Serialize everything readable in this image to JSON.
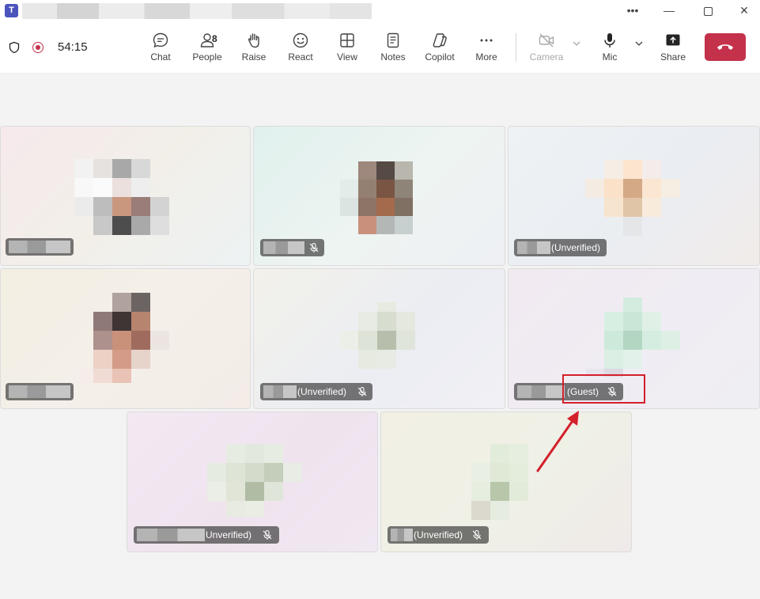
{
  "window": {
    "app_logo": "T",
    "app": "Microsoft Teams"
  },
  "titlebar": {
    "more_icon": "ellipsis-icon",
    "minimize_icon": "minimize-icon",
    "maximize_icon": "maximize-icon",
    "close_icon": "close-icon"
  },
  "status": {
    "timer": "54:15"
  },
  "toolbar": {
    "chat": "Chat",
    "people": "People",
    "people_count": "8",
    "raise": "Raise",
    "react": "React",
    "view": "View",
    "notes": "Notes",
    "copilot": "Copilot",
    "more": "More",
    "camera": "Camera",
    "mic": "Mic",
    "share": "Share"
  },
  "participants": [
    {
      "suffix": "",
      "muted": false
    },
    {
      "suffix": "",
      "muted": true
    },
    {
      "suffix": "(Unverified)",
      "muted": false
    },
    {
      "suffix": "",
      "muted": false
    },
    {
      "suffix": "(Unverified)",
      "muted": true
    },
    {
      "suffix": "(Guest)",
      "muted": true
    },
    {
      "suffix": "Unverified)",
      "muted": true
    },
    {
      "suffix": "(Unverified)",
      "muted": true
    }
  ],
  "colors": {
    "leave": "#c4314b",
    "record": "#c4314b",
    "annotation": "#d3202b",
    "teams_brand": "#4b53bc"
  }
}
